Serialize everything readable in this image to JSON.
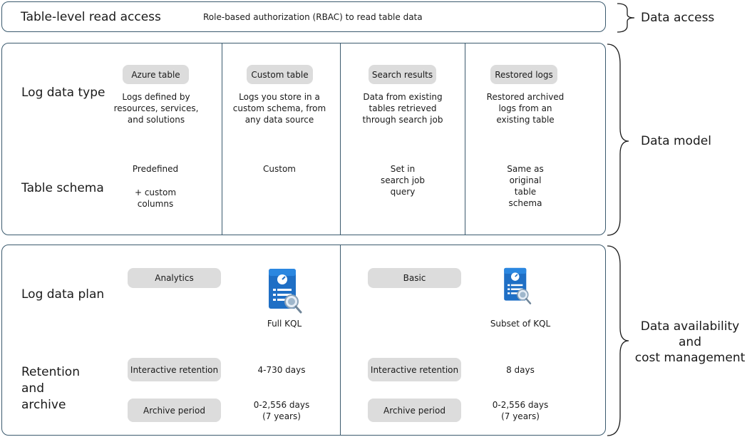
{
  "data_access": {
    "title": "Table-level read access",
    "description": "Role-based authorization (RBAC) to read table data"
  },
  "data_model": {
    "log_data_type_label": "Log data type",
    "table_schema_label": "Table schema",
    "columns": [
      {
        "pill": "Azure table",
        "lines": [
          "Logs defined by",
          "resources, services,",
          "and solutions"
        ],
        "schema": [
          "Predefined",
          "",
          "+ custom",
          "columns"
        ]
      },
      {
        "pill": "Custom table",
        "lines": [
          "Logs you store in a",
          "custom schema, from",
          "any data source"
        ],
        "schema": [
          "Custom"
        ]
      },
      {
        "pill": "Search results",
        "lines": [
          "Data from existing",
          "tables retrieved",
          "through search job"
        ],
        "schema": [
          "Set in",
          "search job",
          "query"
        ]
      },
      {
        "pill": "Restored logs",
        "lines": [
          "Restored archived",
          "logs from an",
          "existing table"
        ],
        "schema": [
          "Same as",
          "original",
          "table",
          "schema"
        ]
      }
    ]
  },
  "availability": {
    "log_data_plan_label": "Log data plan",
    "retention_label": [
      "Retention",
      "and",
      "archive"
    ],
    "plans": [
      {
        "pill": "Analytics",
        "query": "Full KQL",
        "interactive_label": "Interactive retention",
        "interactive_value": "4-730 days",
        "archive_label": "Archive period",
        "archive_value": [
          "0-2,556 days",
          "(7 years)"
        ]
      },
      {
        "pill": "Basic",
        "query": "Subset of KQL",
        "interactive_label": "Interactive retention",
        "interactive_value": "8 days",
        "archive_label": "Archive period",
        "archive_value": [
          "0-2,556 days",
          "(7 years)"
        ]
      }
    ]
  },
  "side_labels": {
    "data_access": "Data access",
    "data_model": "Data model",
    "availability": [
      "Data availability",
      "and",
      "cost management"
    ]
  },
  "colors": {
    "border": "#3b5a6e",
    "pill": "#dcdcdc",
    "icon_blue": "#1f6fc5"
  },
  "icons": [
    "log-query-icon"
  ]
}
